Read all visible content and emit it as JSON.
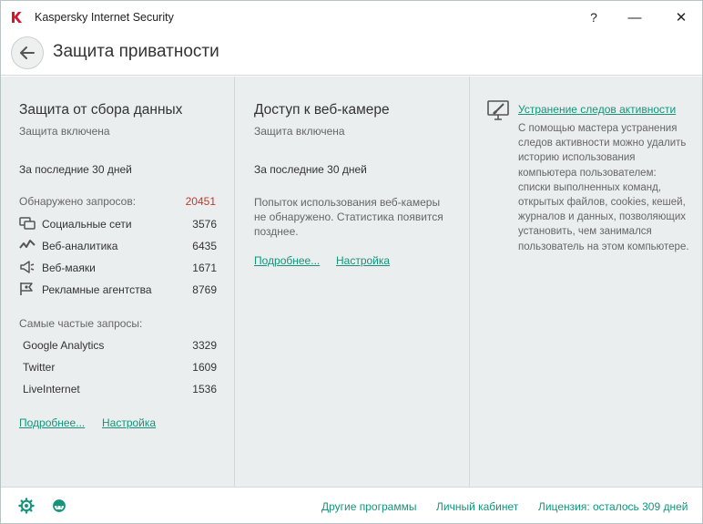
{
  "window": {
    "title": "Kaspersky Internet Security",
    "help_glyph": "?",
    "minimize_glyph": "—",
    "close_glyph": "✕"
  },
  "header": {
    "title": "Защита приватности"
  },
  "data_protection": {
    "title": "Защита от сбора данных",
    "status": "Защита включена",
    "period": "За последние 30 дней",
    "found_label": "Обнаружено запросов:",
    "found_value": "20451",
    "categories": [
      {
        "icon": "social-networks-icon",
        "label": "Социальные сети",
        "value": "3576"
      },
      {
        "icon": "web-analytics-icon",
        "label": "Веб-аналитика",
        "value": "6435"
      },
      {
        "icon": "web-beacons-icon",
        "label": "Веб-маяки",
        "value": "1671"
      },
      {
        "icon": "ad-agencies-icon",
        "label": "Рекламные агентства",
        "value": "8769"
      }
    ],
    "frequent_label": "Самые частые запросы:",
    "frequent": [
      {
        "name": "Google Analytics",
        "value": "3329"
      },
      {
        "name": "Twitter",
        "value": "1609"
      },
      {
        "name": "LiveInternet",
        "value": "1536"
      }
    ],
    "more_link": "Подробнее...",
    "settings_link": "Настройка"
  },
  "webcam": {
    "title": "Доступ к веб-камере",
    "status": "Защита включена",
    "period": "За последние 30 дней",
    "message": "Попыток использования веб-камеры не обнаружено. Статистика появится позднее.",
    "more_link": "Подробнее...",
    "settings_link": "Настройка"
  },
  "activity_cleanup": {
    "icon": "monitor-brush-icon",
    "link": "Устранение следов активности",
    "description": "С помощью мастера устранения следов активности можно удалить историю использования компьютера пользователем: списки выполненных команд, открытых файлов, cookies, кешей, журналов и данных, позволяющих установить, чем занимался пользователь на этом компьютере."
  },
  "footer": {
    "settings_icon": "gear-icon",
    "support_icon": "support-agent-icon",
    "other_programs": "Другие программы",
    "my_account": "Личный кабинет",
    "license": "Лицензия: осталось 309 дней"
  },
  "colors": {
    "accent": "#14947a",
    "alert": "#c0392b",
    "panel_bg": "#eaeeee"
  }
}
